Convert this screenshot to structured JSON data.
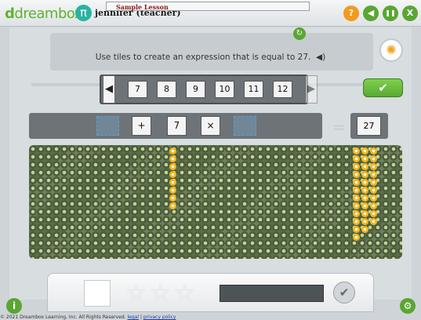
{
  "app": {
    "logo_prefix": "d",
    "logo_text": "dreambox",
    "user_symbol": "π",
    "user_name": "jennifer (teacher)"
  },
  "top_buttons": [
    {
      "name": "help-button",
      "icon": "question-icon",
      "glyph": "?",
      "color": "#f39a1e"
    },
    {
      "name": "sound-button",
      "icon": "speaker-icon",
      "glyph": "◀",
      "color": "#5aa632"
    },
    {
      "name": "pause-button",
      "icon": "pause-icon",
      "glyph": "❚❚",
      "color": "#5aa632"
    },
    {
      "name": "close-button",
      "icon": "close-icon",
      "glyph": "X",
      "color": "#5aa632"
    }
  ],
  "lesson": {
    "ribbon_label": "Sample Lesson",
    "instructions": "Use tiles to create an expression that is equal to 27."
  },
  "tiles": [
    "7",
    "8",
    "9",
    "10",
    "11",
    "12"
  ],
  "expression": {
    "operators": [
      "+",
      "7",
      "×"
    ],
    "equals": "=",
    "target": "27"
  },
  "footer": {
    "copyright": "© 2021 Dreambox Learning, Inc. All Rights Reserved.",
    "legal": "legal",
    "separator": "|",
    "privacy": "privacy policy"
  }
}
